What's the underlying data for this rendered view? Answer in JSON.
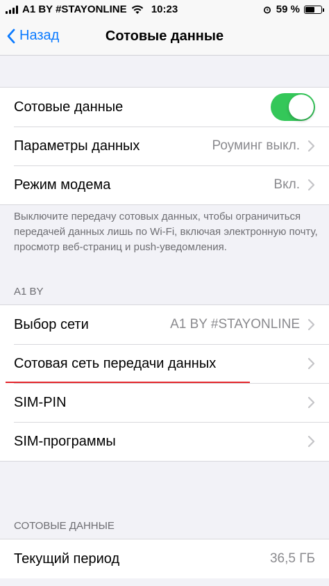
{
  "status_bar": {
    "carrier": "A1 BY #STAYONLINE",
    "time": "10:23",
    "battery": "59 %",
    "battery_level": 0.59,
    "icons": [
      "signal-icon",
      "wifi-icon",
      "alarm-icon",
      "battery-icon"
    ]
  },
  "nav": {
    "back_label": "Назад",
    "title": "Сотовые данные"
  },
  "group1": {
    "cellular_data_label": "Сотовые данные",
    "cellular_data_on": true,
    "data_options_label": "Параметры данных",
    "data_options_value": "Роуминг выкл.",
    "hotspot_label": "Режим модема",
    "hotspot_value": "Вкл."
  },
  "footnote": "Выключите передачу сотовых данных, чтобы ограничиться передачей данных лишь по Wi-Fi, включая электронную почту, просмотр веб-страниц и push-уведомления.",
  "carrier_section": {
    "header": "A1 BY",
    "network_selection_label": "Выбор сети",
    "network_selection_value": "A1 BY #STAYONLINE",
    "cellular_network_label": "Сотовая сеть передачи данных",
    "sim_pin_label": "SIM-PIN",
    "sim_apps_label": "SIM-программы"
  },
  "usage_section": {
    "header": "СОТОВЫЕ ДАННЫЕ",
    "current_period_label": "Текущий период",
    "current_period_value": "36,5 ГБ"
  },
  "colors": {
    "accent": "#0a7aff",
    "toggle_on": "#34c759",
    "highlight": "#e4242a"
  }
}
